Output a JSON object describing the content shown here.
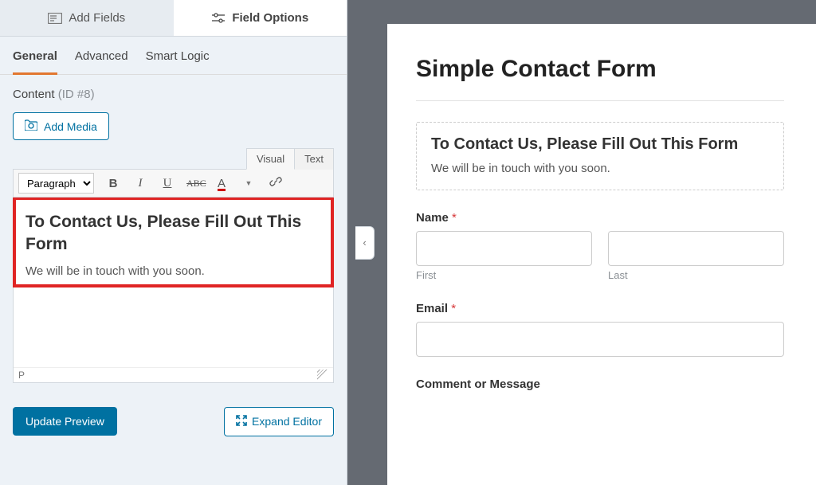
{
  "topTabs": {
    "addFields": "Add Fields",
    "fieldOptions": "Field Options"
  },
  "subTabs": {
    "general": "General",
    "advanced": "Advanced",
    "smartLogic": "Smart Logic"
  },
  "content": {
    "label": "Content",
    "id": "(ID #8)"
  },
  "addMedia": "Add Media",
  "editorTabs": {
    "visual": "Visual",
    "text": "Text"
  },
  "toolbar": {
    "formatSelect": "Paragraph"
  },
  "editorContent": {
    "heading": "To Contact Us, Please Fill Out This Form",
    "paragraph": "We will be in touch with you soon."
  },
  "statusPath": "P",
  "buttons": {
    "updatePreview": "Update Preview",
    "expandEditor": "Expand Editor"
  },
  "preview": {
    "title": "Simple Contact Form",
    "intro": {
      "heading": "To Contact Us, Please Fill Out This Form",
      "paragraph": "We will be in touch with you soon."
    },
    "name": {
      "label": "Name",
      "first": "First",
      "last": "Last"
    },
    "email": {
      "label": "Email"
    },
    "comment": {
      "label": "Comment or Message"
    },
    "required": "*"
  }
}
